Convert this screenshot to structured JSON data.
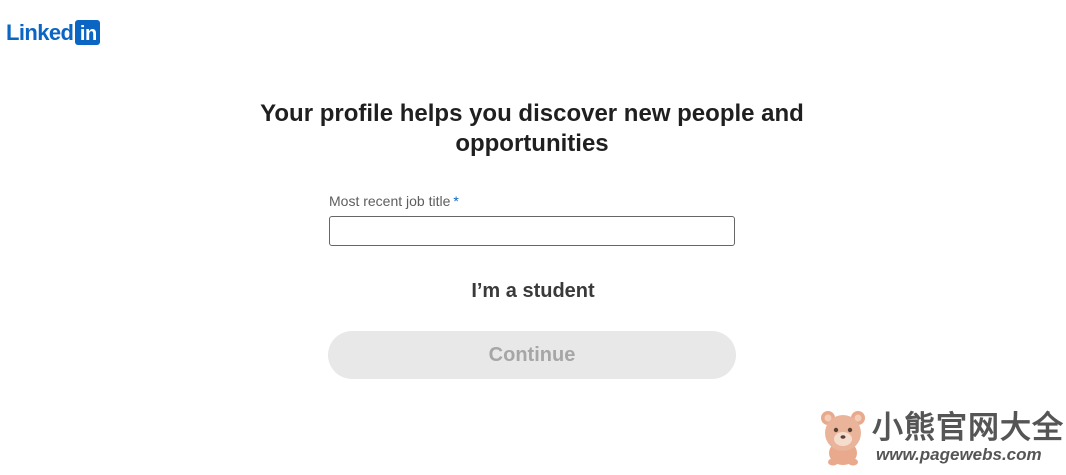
{
  "brand": {
    "wordmark": "Linked",
    "badge": "in",
    "color": "#0a66c2"
  },
  "main": {
    "headline": "Your profile helps you discover new people and opportunities",
    "job_title_field": {
      "label": "Most recent job title",
      "required_marker": "*",
      "value": "",
      "placeholder": ""
    },
    "student_link": "I’m a student",
    "continue_button": {
      "label": "Continue",
      "state": "disabled"
    }
  },
  "watermark": {
    "title": "小熊官网大全",
    "url": "www.pagewebs.com",
    "icon": "bear-icon"
  }
}
